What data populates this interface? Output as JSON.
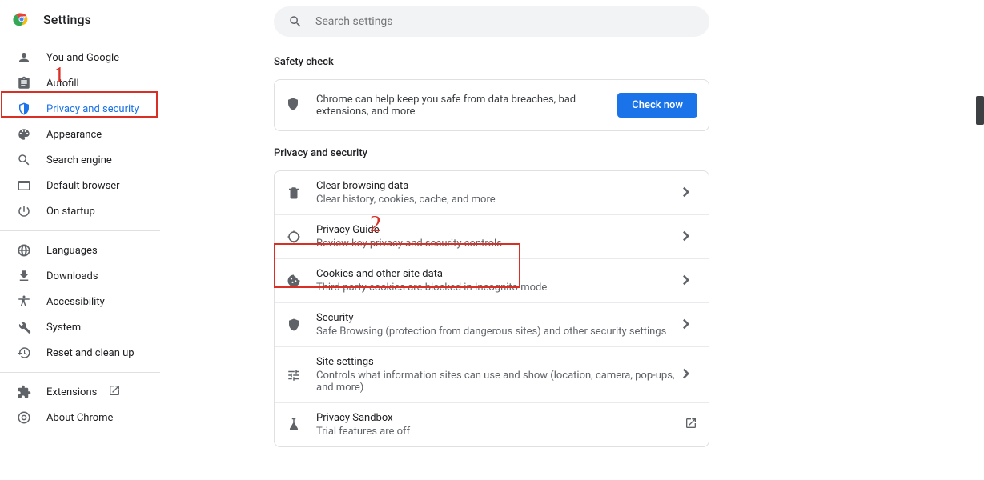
{
  "header": {
    "title": "Settings"
  },
  "search": {
    "placeholder": "Search settings"
  },
  "sidebar": {
    "groups": [
      [
        {
          "icon": "person",
          "label": "You and Google"
        },
        {
          "icon": "assignment",
          "label": "Autofill"
        },
        {
          "icon": "shield-half",
          "label": "Privacy and security",
          "selected": true
        },
        {
          "icon": "palette",
          "label": "Appearance"
        },
        {
          "icon": "search",
          "label": "Search engine"
        },
        {
          "icon": "browser",
          "label": "Default browser"
        },
        {
          "icon": "power",
          "label": "On startup"
        }
      ],
      [
        {
          "icon": "globe",
          "label": "Languages"
        },
        {
          "icon": "download",
          "label": "Downloads"
        },
        {
          "icon": "accessibility",
          "label": "Accessibility"
        },
        {
          "icon": "wrench",
          "label": "System"
        },
        {
          "icon": "restore",
          "label": "Reset and clean up"
        }
      ],
      [
        {
          "icon": "extension",
          "label": "Extensions",
          "external": true
        },
        {
          "icon": "chrome",
          "label": "About Chrome"
        }
      ]
    ]
  },
  "safety": {
    "section_title": "Safety check",
    "text": "Chrome can help keep you safe from data breaches, bad extensions, and more",
    "button": "Check now"
  },
  "privacy": {
    "section_title": "Privacy and security",
    "rows": [
      {
        "icon": "trash",
        "title": "Clear browsing data",
        "sub": "Clear history, cookies, cache, and more"
      },
      {
        "icon": "target",
        "title": "Privacy Guide",
        "sub": "Review key privacy and security controls"
      },
      {
        "icon": "cookie",
        "title": "Cookies and other site data",
        "sub": "Third-party cookies are blocked in Incognito mode"
      },
      {
        "icon": "shield",
        "title": "Security",
        "sub": "Safe Browsing (protection from dangerous sites) and other security settings"
      },
      {
        "icon": "tune",
        "title": "Site settings",
        "sub": "Controls what information sites can use and show (location, camera, pop-ups, and more)"
      },
      {
        "icon": "flask",
        "title": "Privacy Sandbox",
        "sub": "Trial features are off",
        "external": true
      }
    ]
  },
  "annotations": {
    "n1": "1",
    "n2": "2"
  }
}
